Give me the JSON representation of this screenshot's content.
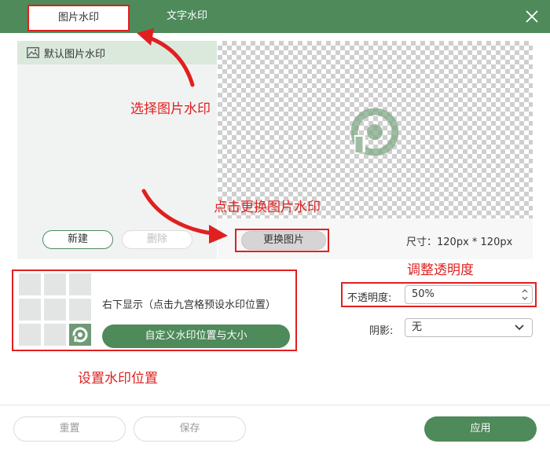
{
  "tabs": [
    {
      "label": "图片水印",
      "active": true
    },
    {
      "label": "文字水印",
      "active": false
    }
  ],
  "theme": {
    "accent": "#4e8a5a",
    "annotation": "#e02020"
  },
  "left_panel": {
    "item_label": "默认图片水印",
    "new_button": "新建",
    "delete_button": "删除"
  },
  "preview": {
    "change_button": "更换图片",
    "size_text": "尺寸：120px * 120px"
  },
  "position": {
    "grid_selected": "bottom-right",
    "text": "右下显示（点击九宫格预设水印位置）",
    "custom_button": "自定义水印位置与大小"
  },
  "opacity": {
    "label": "不透明度:",
    "value": "50%"
  },
  "shadow": {
    "label": "阴影:",
    "value": "无"
  },
  "annotations": {
    "select_image": "选择图片水印",
    "change_image": "点击更换图片水印",
    "adjust_opacity": "调整透明度",
    "set_position": "设置水印位置"
  },
  "footer": {
    "reset": "重置",
    "save": "保存",
    "apply": "应用"
  }
}
